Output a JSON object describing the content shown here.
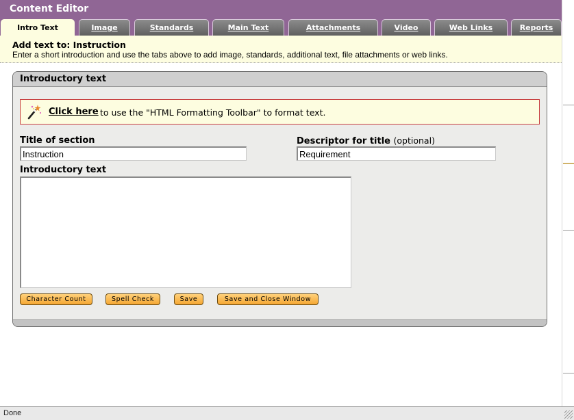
{
  "window": {
    "title": "Content Editor"
  },
  "tabs": [
    {
      "label": "Intro Text",
      "active": true
    },
    {
      "label": "Image",
      "active": false
    },
    {
      "label": "Standards",
      "active": false
    },
    {
      "label": "Main Text",
      "active": false
    },
    {
      "label": "Attachments",
      "active": false
    },
    {
      "label": "Video",
      "active": false
    },
    {
      "label": "Web Links",
      "active": false
    },
    {
      "label": "Reports",
      "active": false
    }
  ],
  "intro": {
    "heading": "Add text to: Instruction",
    "description": "Enter a short introduction and use the tabs above to add image, standards, additional text, file attachments or web links."
  },
  "panel": {
    "title": "Introductory text",
    "toolbar_notice": {
      "icon": "magic-wand-icon",
      "link_label": "Click here",
      "text": "to use the \"HTML Formatting Toolbar\" to format text."
    },
    "fields": {
      "section_title": {
        "label": "Title of section",
        "value": "Instruction"
      },
      "descriptor": {
        "label": "Descriptor for title",
        "optional_label": "(optional)",
        "value": "Requirement"
      },
      "intro_text": {
        "label": "Introductory text",
        "value": ""
      }
    },
    "buttons": {
      "character_count": "Character Count",
      "spell_check": "Spell Check",
      "save": "Save",
      "save_close": "Save and Close Window"
    }
  },
  "status_bar": {
    "text": "Done"
  },
  "colors": {
    "title_bar": "#906695",
    "notice_background": "#fdfde0",
    "notice_border": "#c63c3c",
    "button": "#f5a733"
  }
}
